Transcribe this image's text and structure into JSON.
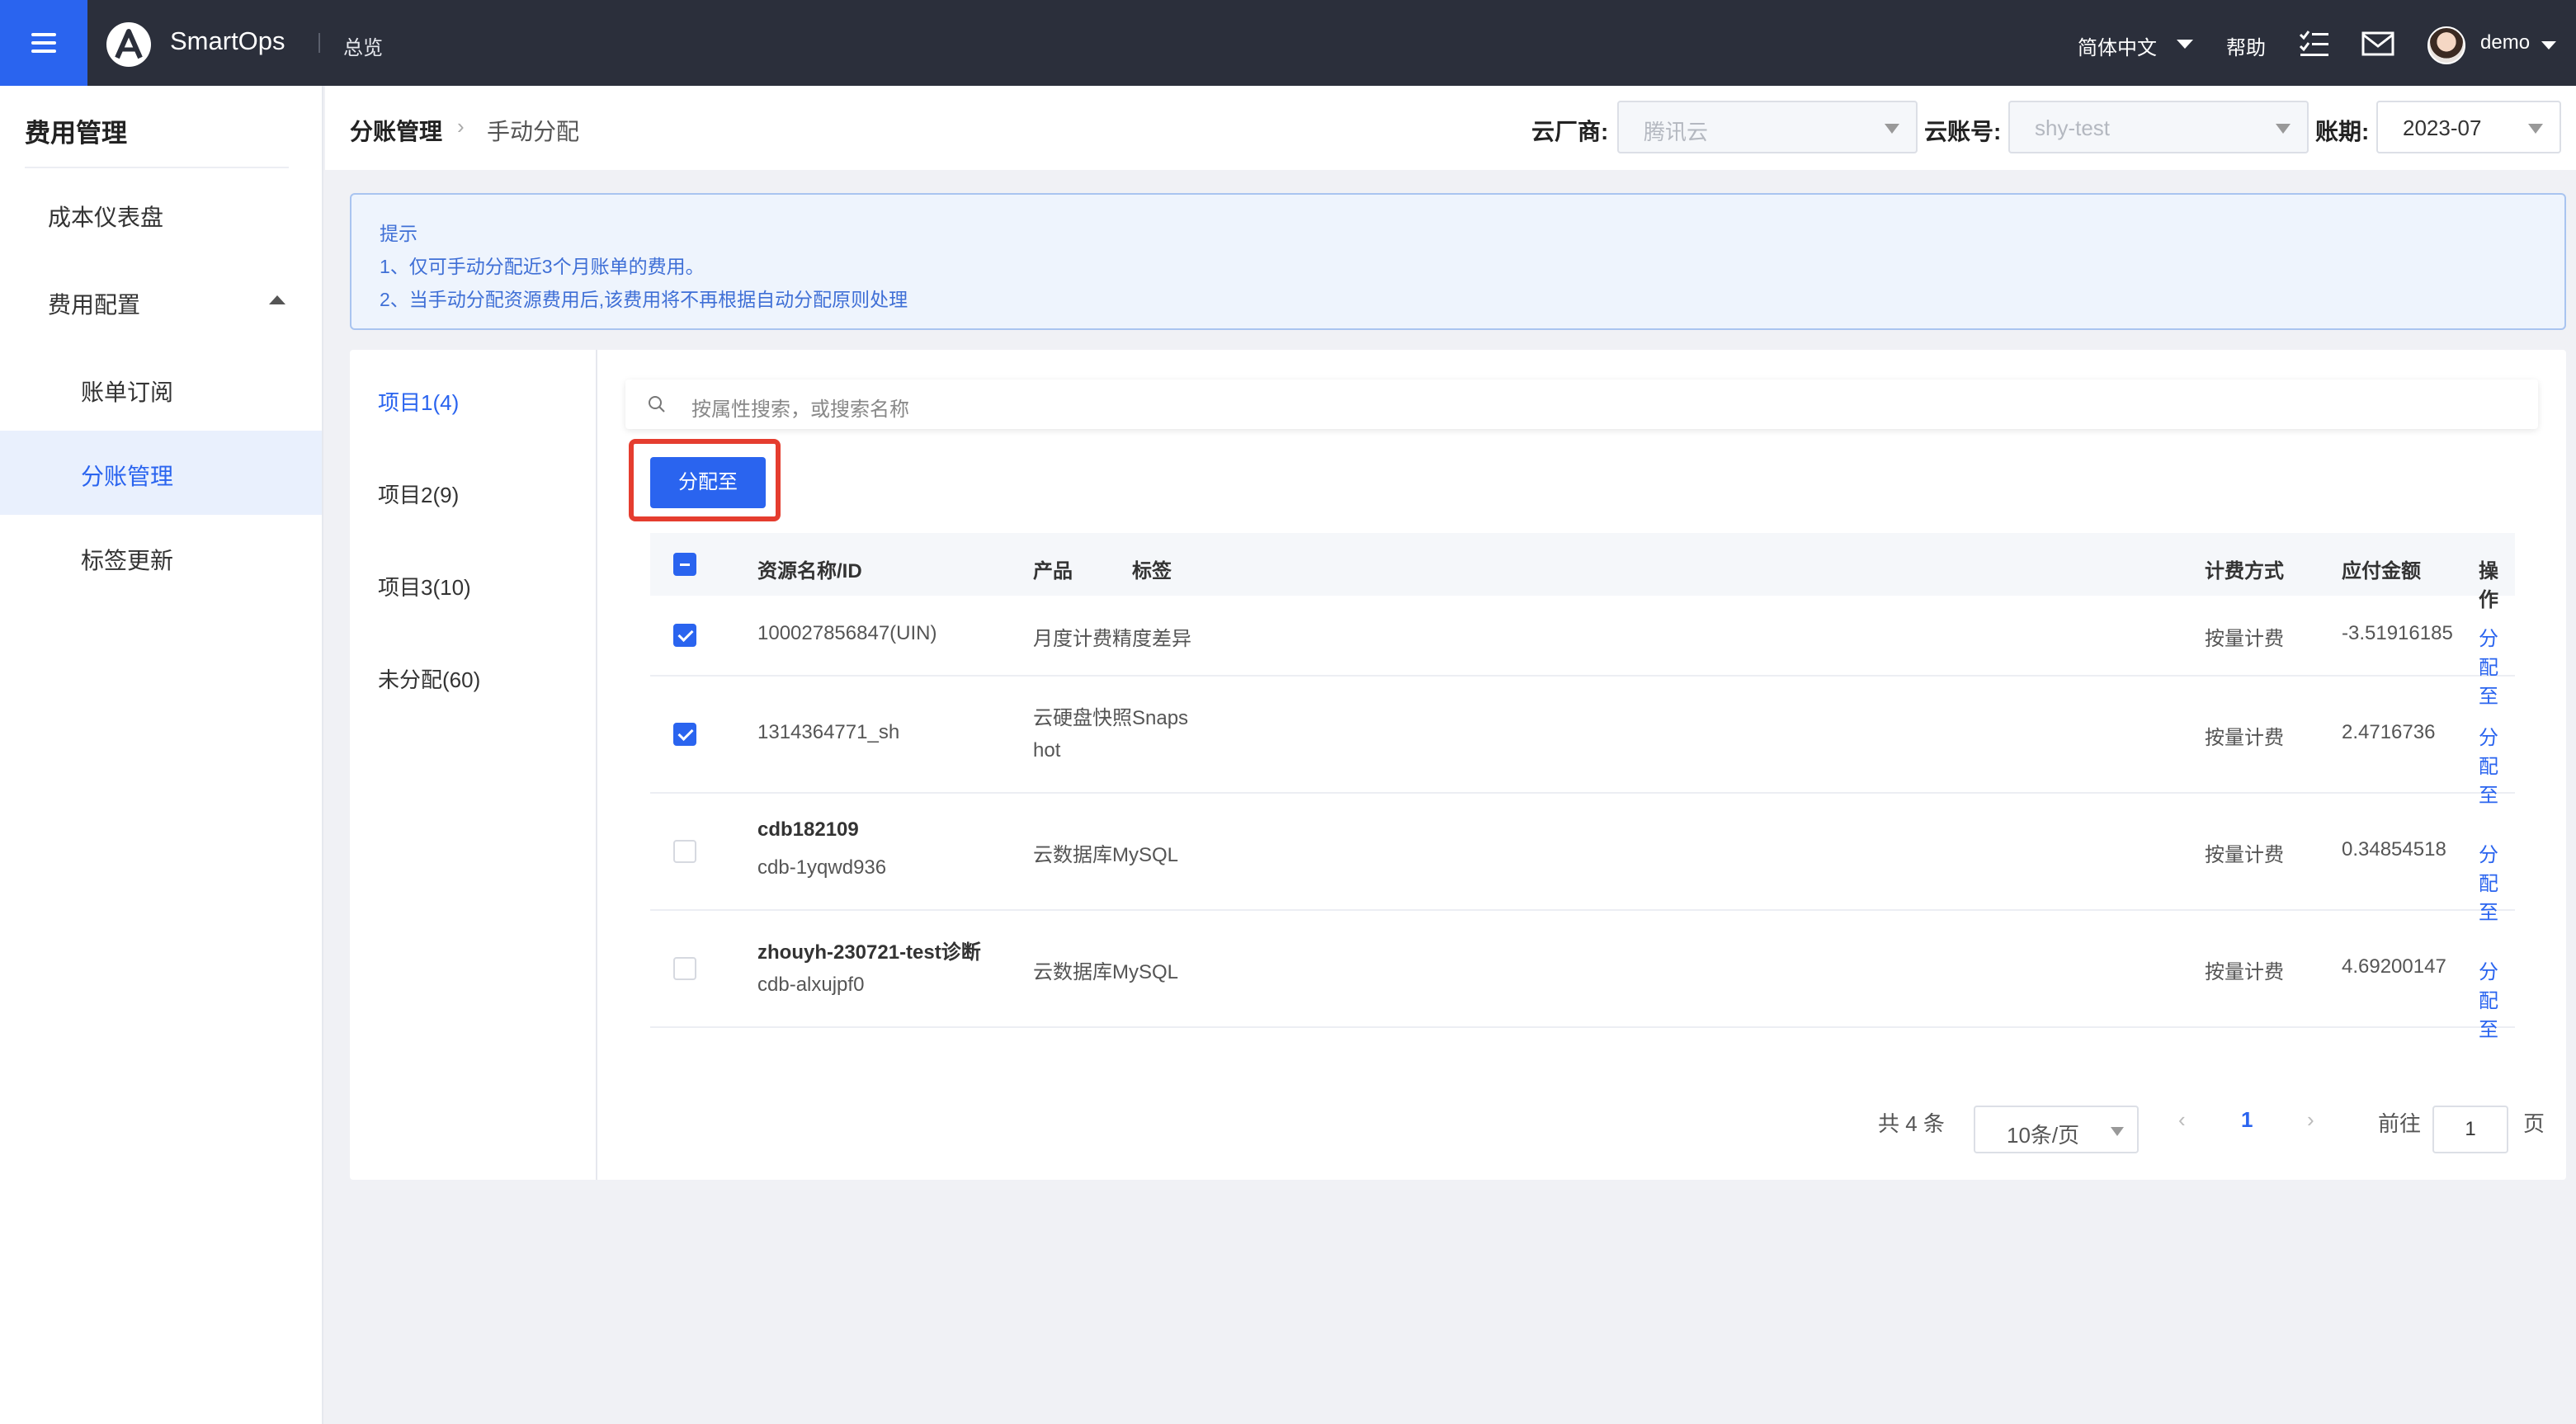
{
  "topbar": {
    "app_name": "SmartOps",
    "overview": "总览",
    "language": "简体中文",
    "help": "帮助",
    "username": "demo"
  },
  "sidebar": {
    "title": "费用管理",
    "items": [
      {
        "label": "成本仪表盘"
      },
      {
        "label": "费用配置"
      },
      {
        "label": "账单订阅"
      },
      {
        "label": "分账管理"
      },
      {
        "label": "标签更新"
      }
    ]
  },
  "header": {
    "breadcrumb_1": "分账管理",
    "breadcrumb_sep": "›",
    "breadcrumb_2": "手动分配",
    "cloud_vendor_label": "云厂商:",
    "cloud_vendor_value": "腾讯云",
    "cloud_account_label": "云账号:",
    "cloud_account_value": "shy-test",
    "period_label": "账期:",
    "period_value": "2023-07"
  },
  "tip": {
    "title": "提示",
    "line1": "1、仅可手动分配近3个月账单的费用。",
    "line2": "2、当手动分配资源费用后,该费用将不再根据自动分配原则处理"
  },
  "projects": [
    {
      "label": "项目1(4)"
    },
    {
      "label": "项目2(9)"
    },
    {
      "label": "项目3(10)"
    },
    {
      "label": "未分配(60)"
    }
  ],
  "search": {
    "placeholder": "按属性搜索，或搜索名称"
  },
  "assign_button": "分配至",
  "table": {
    "headers": {
      "name": "资源名称/ID",
      "product": "产品",
      "tag": "标签",
      "billing": "计费方式",
      "amount": "应付金额",
      "action": "操作"
    },
    "rows": [
      {
        "name": "",
        "id": "100027856847(UIN)",
        "product_1": "月度计费精度差异",
        "product_2": "",
        "billing": "按量计费",
        "amount": "-3.51916185",
        "action": "分配至",
        "checked": true
      },
      {
        "name": "",
        "id": "1314364771_sh",
        "product_1": "云硬盘快照Snaps",
        "product_2": "hot",
        "billing": "按量计费",
        "amount": "2.4716736",
        "action": "分配至",
        "checked": true
      },
      {
        "name": "cdb182109",
        "id": "cdb-1yqwd936",
        "product_1": "云数据库MySQL",
        "product_2": "",
        "billing": "按量计费",
        "amount": "0.34854518",
        "action": "分配至",
        "checked": false
      },
      {
        "name": "zhouyh-230721-test诊断",
        "id": "cdb-alxujpf0",
        "product_1": "云数据库MySQL",
        "product_2": "",
        "billing": "按量计费",
        "amount": "4.69200147",
        "action": "分配至",
        "checked": false
      }
    ]
  },
  "pagination": {
    "total": "共 4 条",
    "page_size": "10条/页",
    "current_page": "1",
    "goto_label": "前往",
    "goto_value": "1",
    "page_unit": "页"
  },
  "colors": {
    "primary": "#2a64ef",
    "topbar": "#2b2f3b",
    "highlight": "#e53d2f"
  }
}
